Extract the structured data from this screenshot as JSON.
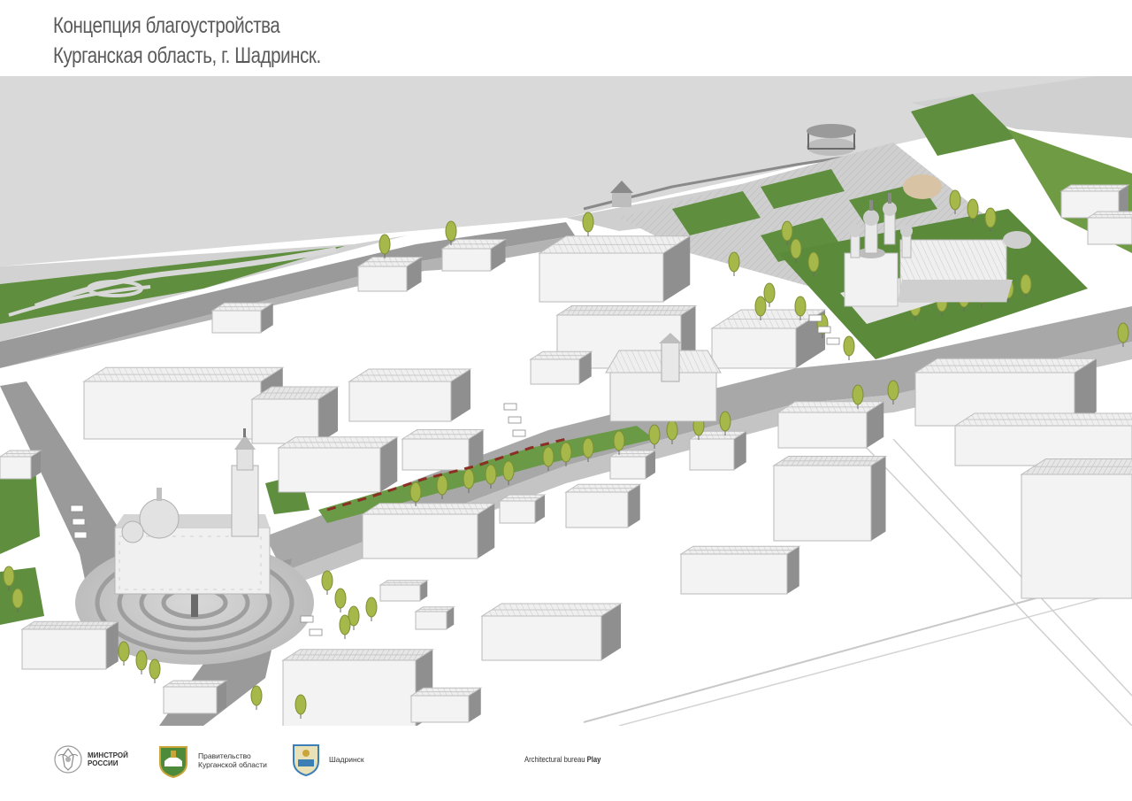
{
  "header": {
    "title_line1": "Концепция благоустройства",
    "title_line2": "Курганская область, г. Шадринск."
  },
  "footer": {
    "logos": [
      {
        "icon": "ministry-emblem-icon",
        "line1": "МИНСТРОЙ",
        "line2": "РОССИИ"
      },
      {
        "icon": "kurgan-coat-of-arms-icon",
        "line1": "Правительство",
        "line2": "Курганской области"
      },
      {
        "icon": "shadrinsk-coat-of-arms-icon",
        "line1": "Шадринск",
        "line2": ""
      }
    ],
    "credit_prefix": "Architectural bureau",
    "credit_name": "Play"
  },
  "colors": {
    "ground": "#ffffff",
    "sky": "#d9d9d9",
    "road": "#8f8f8f",
    "plaza": "#c8c8c8",
    "grass": "#5f8f3e",
    "tree": "#a6b84a",
    "roof": "#ececec",
    "wall": "#9a9a9a",
    "title_text": "#5a5a5a"
  }
}
